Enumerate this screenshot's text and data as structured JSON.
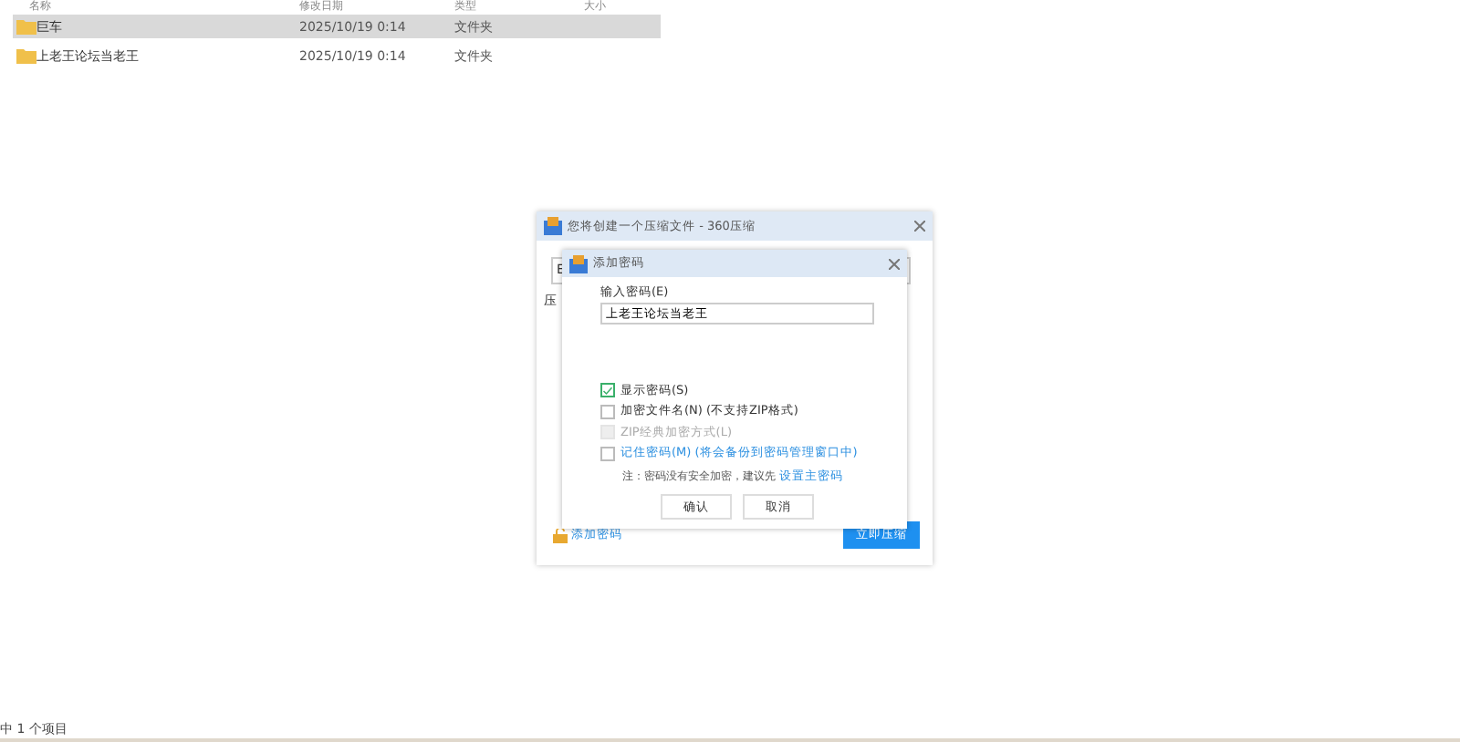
{
  "file_list": {
    "columns": [
      "名称",
      "修改日期",
      "类型",
      "大小"
    ],
    "rows": [
      {
        "name": "巨车",
        "modified": "2025/10/19 0:14",
        "type": "文件夹",
        "selected": true
      },
      {
        "name": "上老王论坛当老王",
        "modified": "2025/10/19 0:14",
        "type": "文件夹",
        "selected": false
      }
    ]
  },
  "status_bar": "中 1 个项目",
  "compress_dialog": {
    "title": "您将创建一个压缩文件 - 360压缩",
    "field_letter": "E",
    "label_letter": "压",
    "add_password_link": "添加密码",
    "compress_button": "立即压缩"
  },
  "password_dialog": {
    "title": "添加密码",
    "password_label": "输入密码(E)",
    "password_value": "上老王论坛当老王",
    "options": [
      {
        "label": "显示密码(S)",
        "checked": true,
        "disabled": false,
        "link": false
      },
      {
        "label": "加密文件名(N) (不支持ZIP格式)",
        "checked": false,
        "disabled": false,
        "link": false
      },
      {
        "label": "ZIP经典加密方式(L)",
        "checked": false,
        "disabled": true,
        "link": false
      },
      {
        "label": "记住密码(M) (将会备份到密码管理窗口中)",
        "checked": false,
        "disabled": false,
        "link": true
      }
    ],
    "note": "注：密码没有安全加密，建议先",
    "note_link": "设置主密码",
    "buttons": [
      "确认",
      "取消"
    ]
  }
}
